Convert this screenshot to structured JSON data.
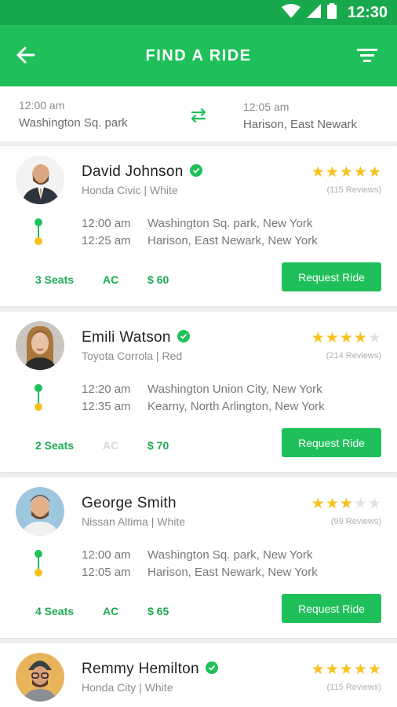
{
  "status_bar": {
    "time": "12:30"
  },
  "header": {
    "title": "FIND A RIDE"
  },
  "route": {
    "from_time": "12:00 am",
    "from_place": "Washington Sq. park",
    "to_time": "12:05 am",
    "to_place": "Harison, East Newark"
  },
  "colors": {
    "primary": "#1fc05a",
    "status_bar": "#18a94d",
    "star": "#f7c21e",
    "star_empty": "#e3e3e3"
  },
  "rides": [
    {
      "name": "David Johnson",
      "car": "Honda Civic",
      "color": "White",
      "rating": 5,
      "reviews": "(115 Reviews)",
      "pickup_time": "12:00 am",
      "pickup_place": "Washington Sq. park, New York",
      "dropoff_time": "12:25 am",
      "dropoff_place": "Harison, East Newark, New York",
      "seats": "3 Seats",
      "ac": "AC",
      "ac_available": true,
      "price": "$ 60",
      "action": "Request Ride"
    },
    {
      "name": "Emili Watson",
      "car": "Toyota Corrola",
      "color": "Red",
      "rating": 4,
      "reviews": "(214 Reviews)",
      "pickup_time": "12:20 am",
      "pickup_place": "Washington Union City, New York",
      "dropoff_time": "12:35 am",
      "dropoff_place": "Kearny, North Arlington, New York",
      "seats": "2 Seats",
      "ac": "AC",
      "ac_available": false,
      "price": "$ 70",
      "action": "Request Ride"
    },
    {
      "name": "George Smith",
      "car": "Nissan Altima",
      "color": "White",
      "rating": 3,
      "reviews": "(99 Reviews)",
      "pickup_time": "12:00 am",
      "pickup_place": "Washington Sq. park, New York",
      "dropoff_time": "12:05 am",
      "dropoff_place": "Harison, East Newark, New York",
      "seats": "4 Seats",
      "ac": "AC",
      "ac_available": true,
      "price": "$ 65",
      "action": "Request Ride"
    },
    {
      "name": "Remmy Hemilton",
      "car": "Honda City",
      "color": "White",
      "rating": 5,
      "reviews": "(115 Reviews)"
    }
  ],
  "icons": [
    "wifi-icon",
    "signal-icon",
    "battery-icon",
    "back-arrow-icon",
    "filter-icon",
    "swap-icon",
    "verified-icon",
    "star-icon"
  ]
}
